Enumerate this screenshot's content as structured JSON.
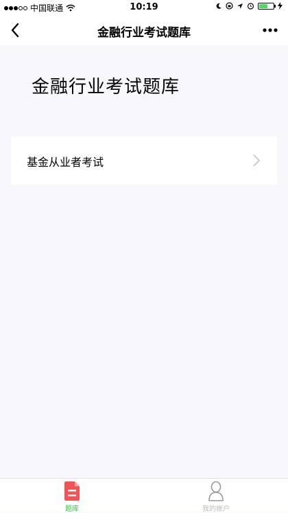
{
  "status_bar": {
    "carrier": "中国联通",
    "time": "10:19",
    "battery_level": 0.6
  },
  "nav": {
    "title": "金融行业考试题库"
  },
  "page": {
    "heading": "金融行业考试题库"
  },
  "list": [
    {
      "label": "基金从业者考试"
    }
  ],
  "tabbar": {
    "tabs": [
      {
        "label": "题库",
        "active": true,
        "icon": "document-icon"
      },
      {
        "label": "我的帐户",
        "active": false,
        "icon": "user-icon"
      }
    ]
  },
  "colors": {
    "accent_green": "#36c63c",
    "tab_icon_red": "#f25454",
    "background": "#f8f7fc"
  }
}
